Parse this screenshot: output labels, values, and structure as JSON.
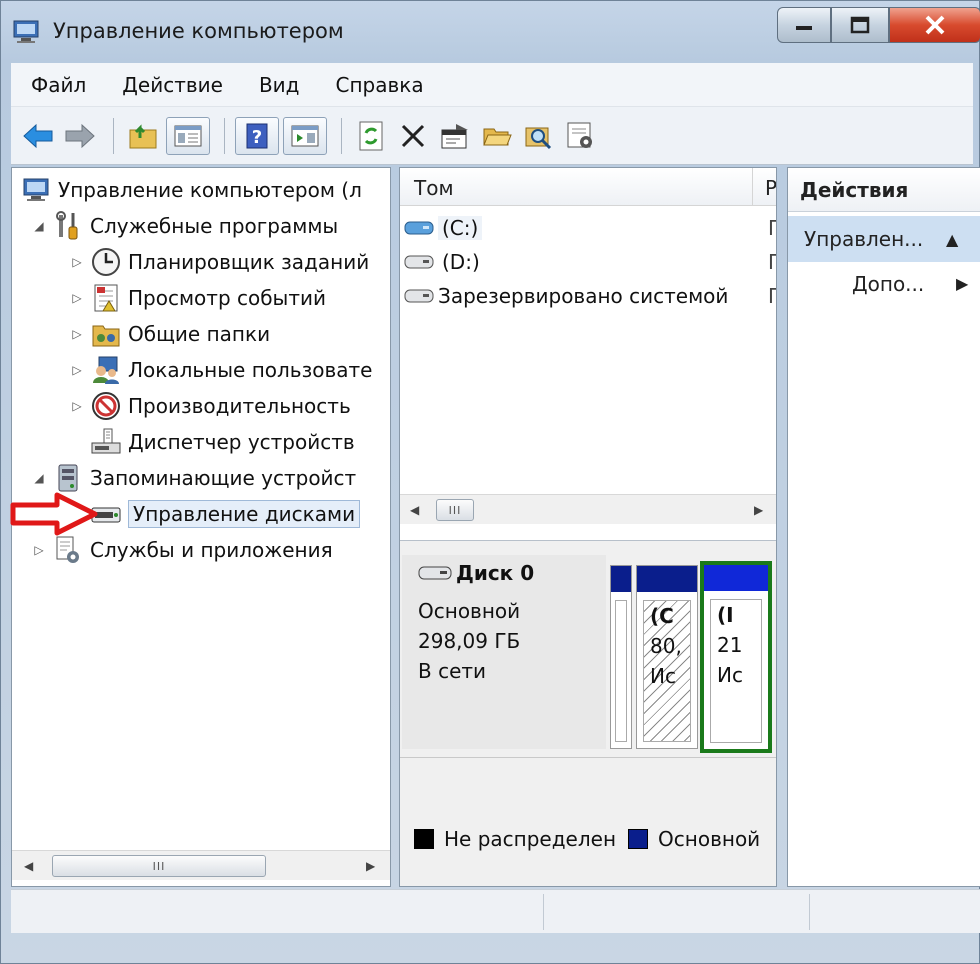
{
  "window": {
    "title": "Управление компьютером"
  },
  "menu": [
    "Файл",
    "Действие",
    "Вид",
    "Справка"
  ],
  "tree": {
    "root": "Управление компьютером (л",
    "utilities": "Служебные программы",
    "task_scheduler": "Планировщик заданий",
    "event_viewer": "Просмотр событий",
    "shared_folders": "Общие папки",
    "local_users": "Локальные пользовате",
    "performance": "Производительность",
    "device_manager": "Диспетчер устройств",
    "storage": "Запоминающие устройст",
    "disk_management": "Управление дисками",
    "services": "Службы и приложения"
  },
  "volumes": {
    "col_tom": "Том",
    "col_r": "Р",
    "rows": [
      {
        "name": "(C:)",
        "r": "П"
      },
      {
        "name": "(D:)",
        "r": "П"
      },
      {
        "name": "Зарезервировано системой",
        "r": "П"
      }
    ]
  },
  "scroll_grip": "III",
  "disk": {
    "name": "Диск 0",
    "type": "Основной",
    "size": "298,09 ГБ",
    "status": "В сети",
    "part_c": {
      "line1": "(С",
      "line2": "80,",
      "line3": "Ис"
    },
    "part_d": {
      "line1": "(I",
      "line2": "21",
      "line3": "Ис"
    }
  },
  "legend": {
    "unallocated": "Не распределен",
    "primary": "Основной",
    "unallocated_color": "#000000",
    "primary_color": "#0a1e8c"
  },
  "actions": {
    "header": "Действия",
    "group": "Управлен...",
    "more": "Допо..."
  }
}
